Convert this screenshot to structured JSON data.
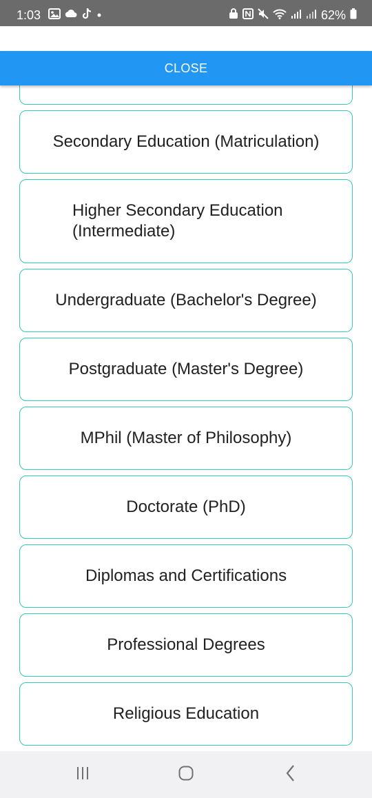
{
  "status_bar": {
    "time": "1:03",
    "battery": "62%"
  },
  "dialog": {
    "close_label": "CLOSE",
    "options": [
      {
        "label": ""
      },
      {
        "label": "Secondary Education (Matriculation)"
      },
      {
        "label": "Higher Secondary Education (Intermediate)"
      },
      {
        "label": "Undergraduate (Bachelor's Degree)"
      },
      {
        "label": "Postgraduate (Master's Degree)"
      },
      {
        "label": "MPhil (Master of Philosophy)"
      },
      {
        "label": "Doctorate (PhD)"
      },
      {
        "label": "Diplomas and Certifications"
      },
      {
        "label": "Professional Degrees"
      },
      {
        "label": "Religious Education"
      }
    ]
  },
  "nav_bar": {
    "recents_icon": "recents-icon",
    "home_icon": "home-icon",
    "back_icon": "back-icon"
  }
}
